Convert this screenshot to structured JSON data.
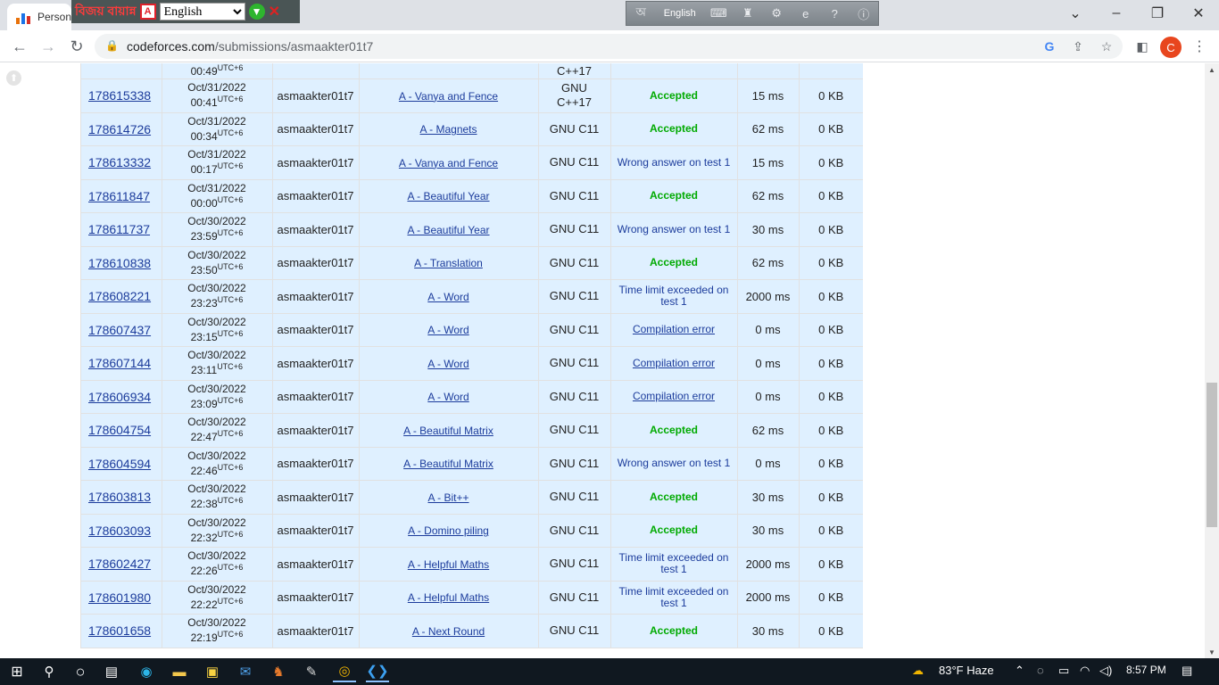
{
  "browser": {
    "tab_title": "Person",
    "url_domain": "codeforces.com",
    "url_path": "/submissions/asmaakter01t7",
    "profile_initial": "C"
  },
  "bijoy": {
    "brand": "বিজয় বায়ান্ন",
    "language_selected": "English"
  },
  "langbar": {
    "language": "English"
  },
  "partial_row": {
    "time": "00:49",
    "tz": "UTC+6",
    "lang": "C++17"
  },
  "submissions": [
    {
      "id": "178615338",
      "date": "Oct/31/2022",
      "time": "00:41",
      "tz": "UTC+6",
      "user": "asmaakter01t7",
      "problem": "A - Vanya and Fence",
      "lang": "GNU C++17",
      "verdict": "Accepted",
      "verdict_type": "ok",
      "time_used": "15 ms",
      "memory": "0 KB"
    },
    {
      "id": "178614726",
      "date": "Oct/31/2022",
      "time": "00:34",
      "tz": "UTC+6",
      "user": "asmaakter01t7",
      "problem": "A - Magnets",
      "lang": "GNU C11",
      "verdict": "Accepted",
      "verdict_type": "ok",
      "time_used": "62 ms",
      "memory": "0 KB"
    },
    {
      "id": "178613332",
      "date": "Oct/31/2022",
      "time": "00:17",
      "tz": "UTC+6",
      "user": "asmaakter01t7",
      "problem": "A - Vanya and Fence",
      "lang": "GNU C11",
      "verdict": "Wrong answer on test 1",
      "verdict_type": "fail",
      "time_used": "15 ms",
      "memory": "0 KB"
    },
    {
      "id": "178611847",
      "date": "Oct/31/2022",
      "time": "00:00",
      "tz": "UTC+6",
      "user": "asmaakter01t7",
      "problem": "A - Beautiful Year",
      "lang": "GNU C11",
      "verdict": "Accepted",
      "verdict_type": "ok",
      "time_used": "62 ms",
      "memory": "0 KB"
    },
    {
      "id": "178611737",
      "date": "Oct/30/2022",
      "time": "23:59",
      "tz": "UTC+6",
      "user": "asmaakter01t7",
      "problem": "A - Beautiful Year",
      "lang": "GNU C11",
      "verdict": "Wrong answer on test 1",
      "verdict_type": "fail",
      "time_used": "30 ms",
      "memory": "0 KB"
    },
    {
      "id": "178610838",
      "date": "Oct/30/2022",
      "time": "23:50",
      "tz": "UTC+6",
      "user": "asmaakter01t7",
      "problem": "A - Translation",
      "lang": "GNU C11",
      "verdict": "Accepted",
      "verdict_type": "ok",
      "time_used": "62 ms",
      "memory": "0 KB"
    },
    {
      "id": "178608221",
      "date": "Oct/30/2022",
      "time": "23:23",
      "tz": "UTC+6",
      "user": "asmaakter01t7",
      "problem": "A - Word",
      "lang": "GNU C11",
      "verdict": "Time limit exceeded on test 1",
      "verdict_type": "fail",
      "time_used": "2000 ms",
      "memory": "0 KB"
    },
    {
      "id": "178607437",
      "date": "Oct/30/2022",
      "time": "23:15",
      "tz": "UTC+6",
      "user": "asmaakter01t7",
      "problem": "A - Word",
      "lang": "GNU C11",
      "verdict": "Compilation error",
      "verdict_type": "link",
      "time_used": "0 ms",
      "memory": "0 KB"
    },
    {
      "id": "178607144",
      "date": "Oct/30/2022",
      "time": "23:11",
      "tz": "UTC+6",
      "user": "asmaakter01t7",
      "problem": "A - Word",
      "lang": "GNU C11",
      "verdict": "Compilation error",
      "verdict_type": "link",
      "time_used": "0 ms",
      "memory": "0 KB"
    },
    {
      "id": "178606934",
      "date": "Oct/30/2022",
      "time": "23:09",
      "tz": "UTC+6",
      "user": "asmaakter01t7",
      "problem": "A - Word",
      "lang": "GNU C11",
      "verdict": "Compilation error",
      "verdict_type": "link",
      "time_used": "0 ms",
      "memory": "0 KB"
    },
    {
      "id": "178604754",
      "date": "Oct/30/2022",
      "time": "22:47",
      "tz": "UTC+6",
      "user": "asmaakter01t7",
      "problem": "A - Beautiful Matrix",
      "lang": "GNU C11",
      "verdict": "Accepted",
      "verdict_type": "ok",
      "time_used": "62 ms",
      "memory": "0 KB"
    },
    {
      "id": "178604594",
      "date": "Oct/30/2022",
      "time": "22:46",
      "tz": "UTC+6",
      "user": "asmaakter01t7",
      "problem": "A - Beautiful Matrix",
      "lang": "GNU C11",
      "verdict": "Wrong answer on test 1",
      "verdict_type": "fail",
      "time_used": "0 ms",
      "memory": "0 KB"
    },
    {
      "id": "178603813",
      "date": "Oct/30/2022",
      "time": "22:38",
      "tz": "UTC+6",
      "user": "asmaakter01t7",
      "problem": "A - Bit++",
      "lang": "GNU C11",
      "verdict": "Accepted",
      "verdict_type": "ok",
      "time_used": "30 ms",
      "memory": "0 KB"
    },
    {
      "id": "178603093",
      "date": "Oct/30/2022",
      "time": "22:32",
      "tz": "UTC+6",
      "user": "asmaakter01t7",
      "problem": "A - Domino piling",
      "lang": "GNU C11",
      "verdict": "Accepted",
      "verdict_type": "ok",
      "time_used": "30 ms",
      "memory": "0 KB"
    },
    {
      "id": "178602427",
      "date": "Oct/30/2022",
      "time": "22:26",
      "tz": "UTC+6",
      "user": "asmaakter01t7",
      "problem": "A - Helpful Maths",
      "lang": "GNU C11",
      "verdict": "Time limit exceeded on test 1",
      "verdict_type": "fail",
      "time_used": "2000 ms",
      "memory": "0 KB"
    },
    {
      "id": "178601980",
      "date": "Oct/30/2022",
      "time": "22:22",
      "tz": "UTC+6",
      "user": "asmaakter01t7",
      "problem": "A - Helpful Maths",
      "lang": "GNU C11",
      "verdict": "Time limit exceeded on test 1",
      "verdict_type": "fail",
      "time_used": "2000 ms",
      "memory": "0 KB"
    },
    {
      "id": "178601658",
      "date": "Oct/30/2022",
      "time": "22:19",
      "tz": "UTC+6",
      "user": "asmaakter01t7",
      "problem": "A - Next Round",
      "lang": "GNU C11",
      "verdict": "Accepted",
      "verdict_type": "ok",
      "time_used": "30 ms",
      "memory": "0 KB"
    }
  ],
  "taskbar": {
    "weather": "83°F  Haze",
    "clock": "8:57 PM"
  },
  "colors": {
    "row_bg": "#dff0ff",
    "link": "#1c3c9c",
    "accepted": "#00aa00",
    "taskbar": "#101820"
  }
}
